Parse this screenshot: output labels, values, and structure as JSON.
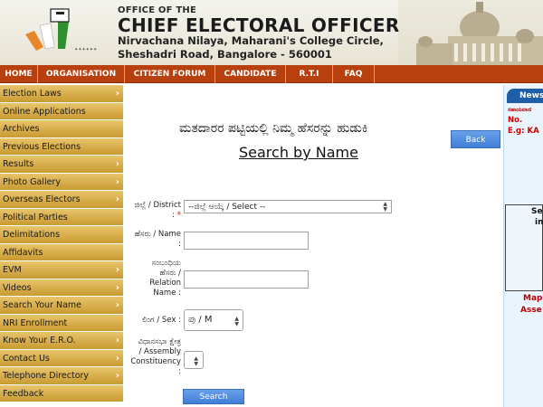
{
  "header": {
    "office_of": "OFFICE OF THE",
    "title": "CHIEF ELECTORAL OFFICER",
    "address_line1": "Nirvachana Nilaya, Maharani's College Circle,",
    "address_line2": "Sheshadri Road, Bangalore - 560001"
  },
  "nav": {
    "items": [
      "HOME",
      "ORGANISATION",
      "CITIZEN FORUM",
      "CANDIDATE",
      "R.T.I",
      "FAQ"
    ]
  },
  "sidebar": {
    "items": [
      {
        "label": "Election Laws",
        "arrow": true
      },
      {
        "label": "Online Applications",
        "arrow": false
      },
      {
        "label": "Archives",
        "arrow": false
      },
      {
        "label": "Previous Elections",
        "arrow": false
      },
      {
        "label": "Results",
        "arrow": true
      },
      {
        "label": "Photo Gallery",
        "arrow": true
      },
      {
        "label": "Overseas Electors",
        "arrow": true
      },
      {
        "label": "Political Parties",
        "arrow": false
      },
      {
        "label": "Delimitations",
        "arrow": false
      },
      {
        "label": "Affidavits",
        "arrow": false
      },
      {
        "label": "EVM",
        "arrow": true
      },
      {
        "label": "Videos",
        "arrow": true
      },
      {
        "label": "Search Your Name",
        "arrow": true
      },
      {
        "label": "NRI Enrollment",
        "arrow": false
      },
      {
        "label": "Know Your E.R.O.",
        "arrow": true
      },
      {
        "label": "Contact Us",
        "arrow": true
      },
      {
        "label": "Telephone Directory",
        "arrow": true
      },
      {
        "label": "Feedback",
        "arrow": false
      }
    ],
    "arrow_glyph": "›"
  },
  "main": {
    "kannada_title": "ಮತದಾರರ ಪಟ್ಟಿಯಲ್ಲಿ ನಿಮ್ಮ ಹೆಸರನ್ನು ಹುಡುಕಿ",
    "search_title": "Search by Name",
    "back_label": "Back",
    "form": {
      "district_label_1": "ಜಿಲ್ಲೆ / District",
      "district_label_2": ":",
      "required_mark": "*",
      "district_value": "--ಜಿಲ್ಲೆ ಆಯ್ಕೆ / Select --",
      "name_label_1": "ಹೆಸರು / Name",
      "name_label_2": ":",
      "name_value": "",
      "relation_label_1": "ಸಂಬಂಧಿಯ",
      "relation_label_2": "ಹೆಸರು /",
      "relation_label_3": "Relation",
      "relation_label_4": "Name :",
      "relation_value": "",
      "sex_label": "ಲಿಂಗ / Sex :",
      "sex_value": "ಪು / M",
      "ac_label_1": "ವಿಧಾನಸಭಾ ಕ್ಷೇತ್ರ",
      "ac_label_2": "/ Assembly",
      "ac_label_3": "Constituency",
      "ac_label_4": ":",
      "ac_value": "",
      "submit_label": "Search"
    }
  },
  "right_panel": {
    "news_tab": "News",
    "news_line0": "ಸಹಾಯವಾಣಿ",
    "news_line1": "No.",
    "news_line2": "E.g: KA",
    "box_line1": "Se",
    "box_line2": "in",
    "map_line1": "Map",
    "map_line2": "Asse"
  },
  "colors": {
    "nav_bg": "#b8400e",
    "sidebar_bg": "#d9ad4a",
    "button_blue": "#4a86dc",
    "accent_red": "#d00000"
  }
}
